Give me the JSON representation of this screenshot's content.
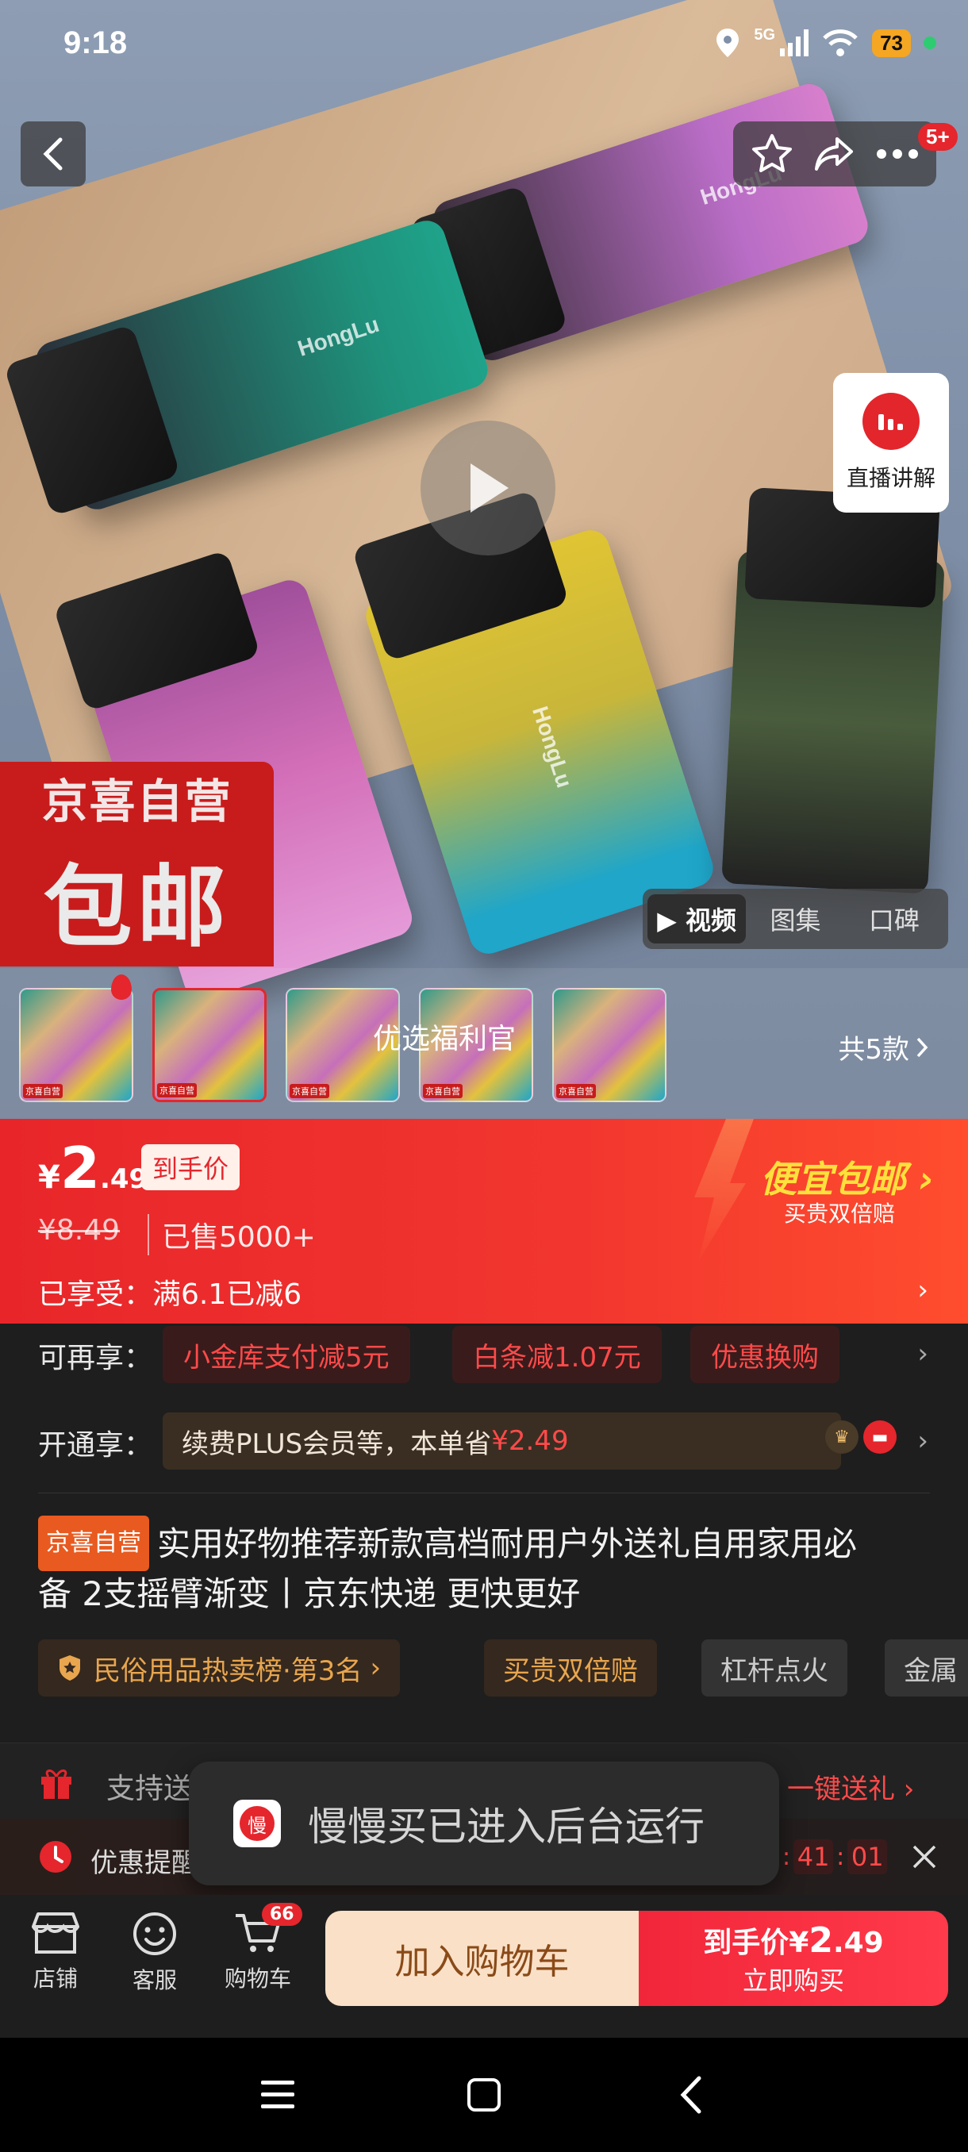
{
  "status_bar": {
    "time": "9:18",
    "network": "5G",
    "battery": "73"
  },
  "top_bar": {
    "more_badge": "5+"
  },
  "live": {
    "label": "直播讲解"
  },
  "hero_banner": {
    "line1": "京喜自营",
    "line2": "包邮"
  },
  "media_tabs": [
    {
      "label": "▶ 视频",
      "active": true
    },
    {
      "label": "图集",
      "active": false
    },
    {
      "label": "口碑",
      "active": false
    }
  ],
  "thumbnails": {
    "caption": "优选福利官",
    "count_label": "共5款",
    "tag": "京喜自营"
  },
  "price_banner": {
    "currency": "¥",
    "price_int": "2",
    "price_dec": ".49",
    "final_price_tag": "到手价",
    "original_price": "¥8.49",
    "sold": "已售5000+",
    "promo_title": "便宜包邮",
    "promo_sub": "买贵双倍赔",
    "enjoyed": "已享受：满6.1已减6"
  },
  "more_offers": {
    "label": "可再享：",
    "chips": [
      "小金库支付减5元",
      "白条减1.07元",
      "优惠换购"
    ]
  },
  "plus": {
    "label": "开通享：",
    "text": "续费PLUS会员等，本单省",
    "saving": "¥2.49"
  },
  "product": {
    "self_tag": "京喜自营",
    "title_line1": "实用好物推荐新款高档耐用户外送礼自用家用必",
    "title_line2": "备 2支摇臂渐变丨京东快递 更快更好"
  },
  "tags": {
    "ranking": "民俗用品热卖榜·第3名",
    "guarantee": "买贵双倍赔",
    "lever": "杠杆点火",
    "metal": "金属"
  },
  "gift": {
    "label": "支持送",
    "action": "一键送礼"
  },
  "remind": {
    "label": "优惠提醒",
    "minutes": "41",
    "seconds": "01"
  },
  "toast": {
    "logo_char": "慢",
    "text": "慢慢买已进入后台运行"
  },
  "action_bar": {
    "store": "店铺",
    "service": "客服",
    "cart": "购物车",
    "cart_badge": "66",
    "add_to_cart": "加入购物车",
    "buy_price_prefix": "到手价",
    "buy_currency": "¥",
    "buy_price_int": "2",
    "buy_price_dec": ".49",
    "buy_now": "立即购买"
  },
  "colors": {
    "accent_red": "#e5262c",
    "promo_yellow": "#ffe03c",
    "cart_bg": "#fae0c6"
  }
}
